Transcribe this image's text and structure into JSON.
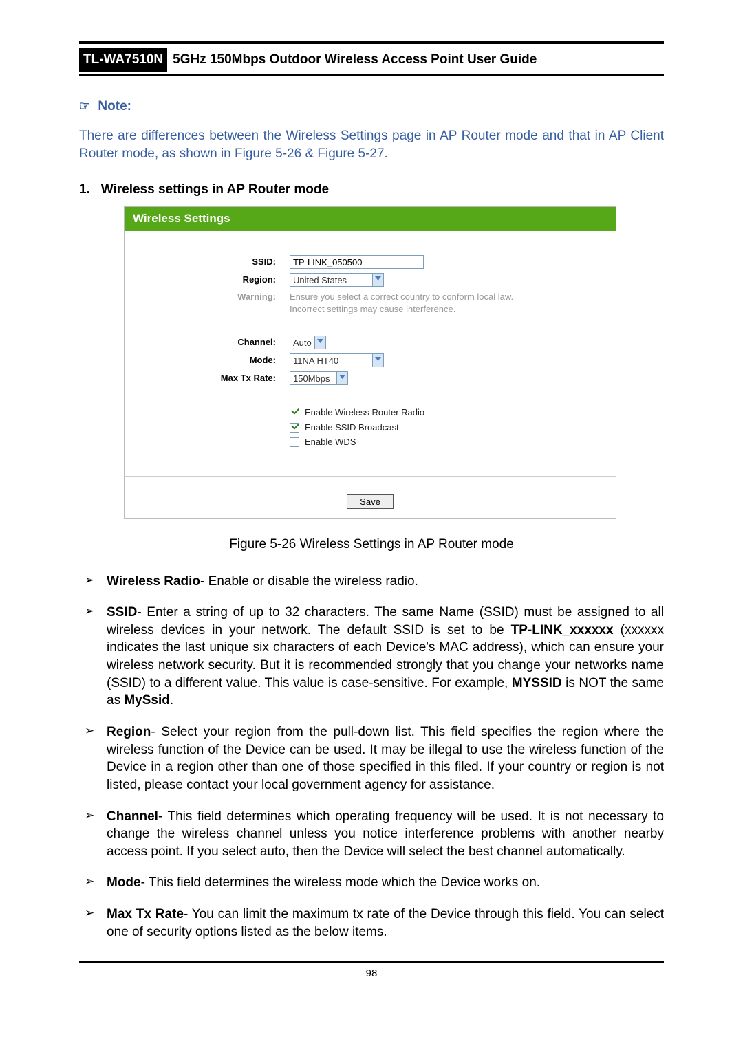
{
  "header": {
    "model": "TL-WA7510N",
    "title": "5GHz 150Mbps Outdoor Wireless Access Point User Guide"
  },
  "note": {
    "icon": "☞",
    "label": "Note:",
    "body": "There are differences between the Wireless Settings page in AP Router mode and that in AP Client Router mode, as shown in Figure 5-26 & Figure 5-27."
  },
  "section": {
    "number": "1.",
    "title": "Wireless settings in AP Router mode"
  },
  "figure": {
    "banner": "Wireless Settings",
    "labels": {
      "ssid": "SSID:",
      "region": "Region:",
      "warning": "Warning:",
      "channel": "Channel:",
      "mode": "Mode:",
      "max_tx": "Max Tx Rate:"
    },
    "values": {
      "ssid": "TP-LINK_050500",
      "region": "United States",
      "warning_line1": "Ensure you select a correct country to conform local law.",
      "warning_line2": "Incorrect settings may cause interference.",
      "channel": "Auto",
      "mode": "11NA HT40",
      "max_tx": "150Mbps"
    },
    "checkboxes": {
      "radio": {
        "checked": true,
        "label": "Enable Wireless Router Radio"
      },
      "bcast": {
        "checked": true,
        "label": "Enable SSID Broadcast"
      },
      "wds": {
        "checked": false,
        "label": "Enable WDS"
      }
    },
    "save": "Save",
    "caption": "Figure 5-26    Wireless Settings in AP Router mode"
  },
  "defs": {
    "wr_term": "Wireless Radio",
    "wr_body": "- Enable or disable the wireless radio.",
    "ssid_term": "SSID",
    "ssid_b1": "- Enter a string of up to 32 characters. The same Name (SSID) must be assigned to all wireless devices in your network. The default SSID is set to be ",
    "ssid_def": "TP-LINK_xxxxxx",
    "ssid_b2": " (xxxxxx indicates the last unique six characters of each Device's MAC address), which can ensure your wireless network security. But it is recommended strongly that you change your networks name (SSID) to a different value. This value is case-sensitive. For example, ",
    "ssid_ex1": "MYSSID",
    "ssid_b3": " is NOT the same as ",
    "ssid_ex2": "MySsid",
    "ssid_b4": ".",
    "region_term": "Region",
    "region_body": "- Select your region from the pull-down list. This field specifies the region where the wireless function of the Device can be used. It may be illegal to use the wireless  function  of the Device in a region other than one of those specified in this filed. If your country or region is not listed, please contact your local government agency for assistance.",
    "channel_term": "Channel",
    "channel_body": "- This field determines which operating frequency will be used. It is not necessary to change the wireless channel unless you notice interference problems with another nearby access point. If you select auto, then the Device will select the best channel  automatically.",
    "mode_term": "Mode",
    "mode_body": "- This field determines the wireless mode which the Device works on.",
    "max_term": "Max Tx Rate",
    "max_body": "- You can limit the maximum tx rate of the Device through this field. You can select one of security options listed as the below items."
  },
  "page_number": "98"
}
